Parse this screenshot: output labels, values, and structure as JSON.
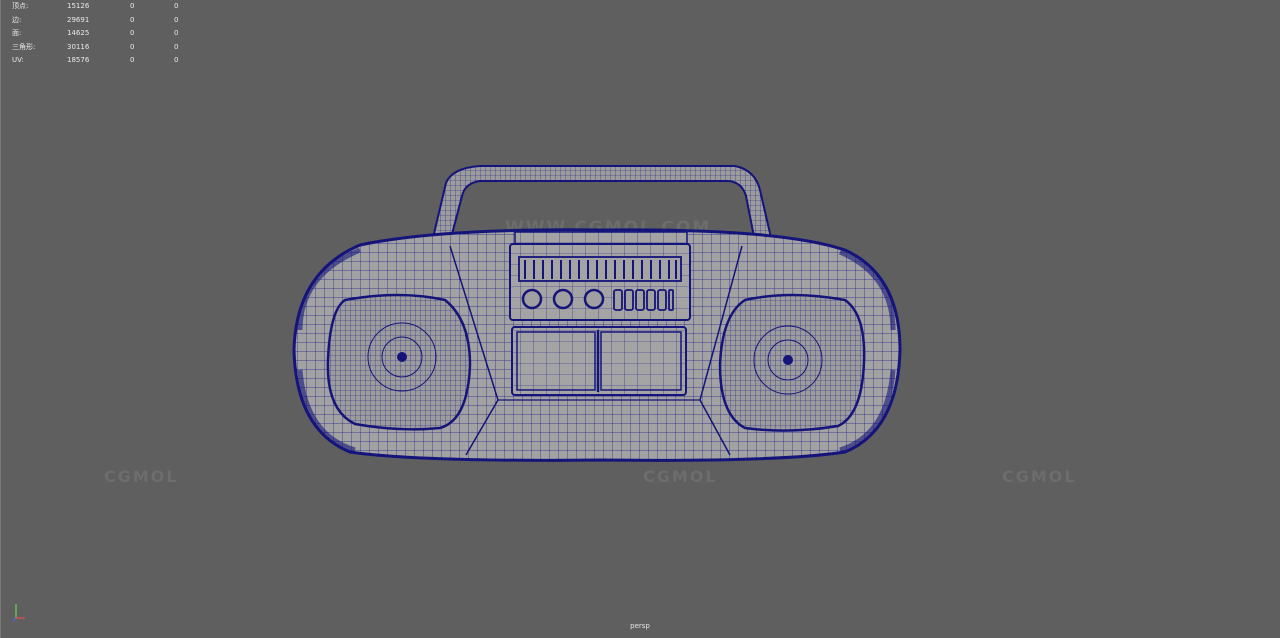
{
  "hud": {
    "rows": [
      {
        "label": "顶点:",
        "v1": "15126",
        "v2": "0",
        "v3": "0"
      },
      {
        "label": "边:",
        "v1": "29691",
        "v2": "0",
        "v3": "0"
      },
      {
        "label": "面:",
        "v1": "14625",
        "v2": "0",
        "v3": "0"
      },
      {
        "label": "三角形:",
        "v1": "30116",
        "v2": "0",
        "v3": "0"
      },
      {
        "label": "UV:",
        "v1": "18576",
        "v2": "0",
        "v3": "0"
      }
    ]
  },
  "watermarks": {
    "cgmol_left": "CGMOL",
    "cgmol_center": "CGMOL",
    "cgmol_right": "CGMOL",
    "cgmol_top": "WWW.CGMOL.COM"
  },
  "camera": {
    "label": "persp"
  },
  "colors": {
    "viewport_bg": "#5f5f5f",
    "wire": "#1a1a8c",
    "shade": "#9a9a9a"
  },
  "icons": {
    "axis": "axis-gizmo-icon"
  }
}
